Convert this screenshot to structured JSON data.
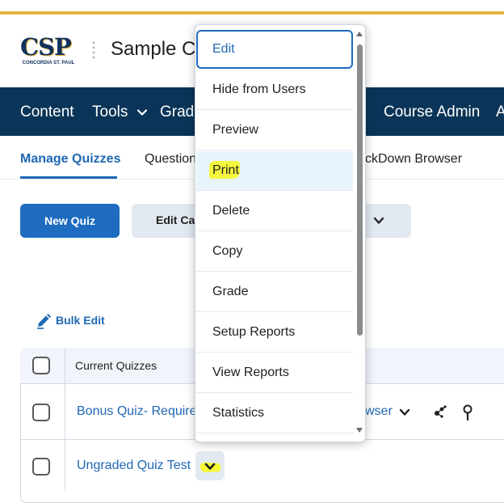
{
  "header": {
    "logo_text": "CSP",
    "logo_subtitle": "CONCORDIA ST. PAUL",
    "course_title": "Sample C"
  },
  "nav": {
    "content": "Content",
    "tools": "Tools",
    "grades": "Grade",
    "course_admin": "Course Admin",
    "overflow": "A"
  },
  "tabs": {
    "manage_quizzes": "Manage Quizzes",
    "question_library": "Question",
    "lockdown": "ckDown Browser"
  },
  "toolbar": {
    "new_quiz": "New Quiz",
    "edit_categories": "Edit Cat"
  },
  "bulk_edit": "Bulk Edit",
  "table": {
    "header": "Current Quizzes",
    "rows": [
      {
        "title": "Bonus Quiz- Require",
        "suffix": "wser"
      },
      {
        "title": "Ungraded Quiz Test"
      }
    ]
  },
  "context_menu": {
    "items": [
      "Edit",
      "Hide from Users",
      "Preview",
      "Print",
      "Delete",
      "Copy",
      "Grade",
      "Setup Reports",
      "View Reports",
      "Statistics"
    ],
    "focused_item": "Edit",
    "hovered_item": "Print"
  },
  "icons": {
    "chevron": "chevron-down-icon",
    "bulk_edit": "pencil-icon",
    "row_tools": [
      "graph-nodes-icon",
      "pin-icon"
    ]
  },
  "colors": {
    "top_stripe": "#e5b53b",
    "navbar": "#0b3558",
    "primary": "#1e6cc0",
    "link": "#1e68b4",
    "highlight": "#f6f734"
  }
}
